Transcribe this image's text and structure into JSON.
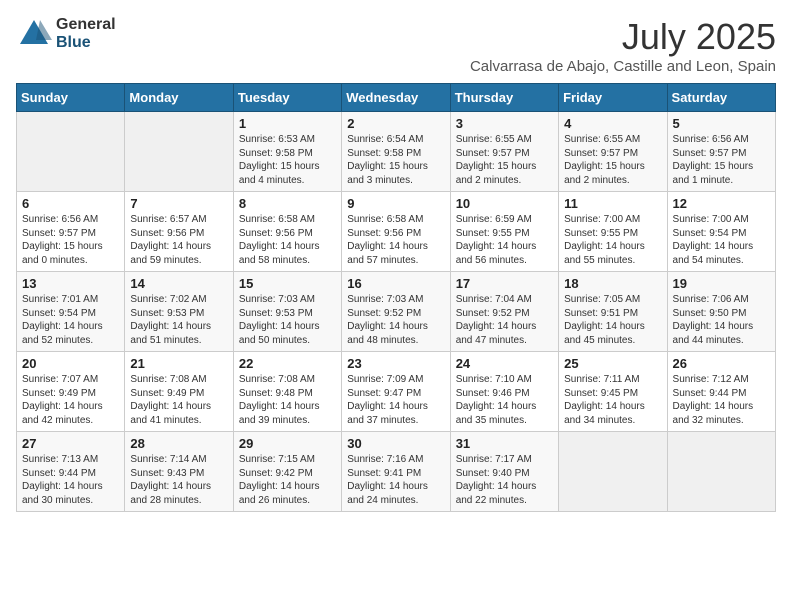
{
  "header": {
    "logo_general": "General",
    "logo_blue": "Blue",
    "title": "July 2025",
    "subtitle": "Calvarrasa de Abajo, Castille and Leon, Spain"
  },
  "days_of_week": [
    "Sunday",
    "Monday",
    "Tuesday",
    "Wednesday",
    "Thursday",
    "Friday",
    "Saturday"
  ],
  "weeks": [
    [
      {
        "day": "",
        "info": ""
      },
      {
        "day": "",
        "info": ""
      },
      {
        "day": "1",
        "info": "Sunrise: 6:53 AM\nSunset: 9:58 PM\nDaylight: 15 hours and 4 minutes."
      },
      {
        "day": "2",
        "info": "Sunrise: 6:54 AM\nSunset: 9:58 PM\nDaylight: 15 hours and 3 minutes."
      },
      {
        "day": "3",
        "info": "Sunrise: 6:55 AM\nSunset: 9:57 PM\nDaylight: 15 hours and 2 minutes."
      },
      {
        "day": "4",
        "info": "Sunrise: 6:55 AM\nSunset: 9:57 PM\nDaylight: 15 hours and 2 minutes."
      },
      {
        "day": "5",
        "info": "Sunrise: 6:56 AM\nSunset: 9:57 PM\nDaylight: 15 hours and 1 minute."
      }
    ],
    [
      {
        "day": "6",
        "info": "Sunrise: 6:56 AM\nSunset: 9:57 PM\nDaylight: 15 hours and 0 minutes."
      },
      {
        "day": "7",
        "info": "Sunrise: 6:57 AM\nSunset: 9:56 PM\nDaylight: 14 hours and 59 minutes."
      },
      {
        "day": "8",
        "info": "Sunrise: 6:58 AM\nSunset: 9:56 PM\nDaylight: 14 hours and 58 minutes."
      },
      {
        "day": "9",
        "info": "Sunrise: 6:58 AM\nSunset: 9:56 PM\nDaylight: 14 hours and 57 minutes."
      },
      {
        "day": "10",
        "info": "Sunrise: 6:59 AM\nSunset: 9:55 PM\nDaylight: 14 hours and 56 minutes."
      },
      {
        "day": "11",
        "info": "Sunrise: 7:00 AM\nSunset: 9:55 PM\nDaylight: 14 hours and 55 minutes."
      },
      {
        "day": "12",
        "info": "Sunrise: 7:00 AM\nSunset: 9:54 PM\nDaylight: 14 hours and 54 minutes."
      }
    ],
    [
      {
        "day": "13",
        "info": "Sunrise: 7:01 AM\nSunset: 9:54 PM\nDaylight: 14 hours and 52 minutes."
      },
      {
        "day": "14",
        "info": "Sunrise: 7:02 AM\nSunset: 9:53 PM\nDaylight: 14 hours and 51 minutes."
      },
      {
        "day": "15",
        "info": "Sunrise: 7:03 AM\nSunset: 9:53 PM\nDaylight: 14 hours and 50 minutes."
      },
      {
        "day": "16",
        "info": "Sunrise: 7:03 AM\nSunset: 9:52 PM\nDaylight: 14 hours and 48 minutes."
      },
      {
        "day": "17",
        "info": "Sunrise: 7:04 AM\nSunset: 9:52 PM\nDaylight: 14 hours and 47 minutes."
      },
      {
        "day": "18",
        "info": "Sunrise: 7:05 AM\nSunset: 9:51 PM\nDaylight: 14 hours and 45 minutes."
      },
      {
        "day": "19",
        "info": "Sunrise: 7:06 AM\nSunset: 9:50 PM\nDaylight: 14 hours and 44 minutes."
      }
    ],
    [
      {
        "day": "20",
        "info": "Sunrise: 7:07 AM\nSunset: 9:49 PM\nDaylight: 14 hours and 42 minutes."
      },
      {
        "day": "21",
        "info": "Sunrise: 7:08 AM\nSunset: 9:49 PM\nDaylight: 14 hours and 41 minutes."
      },
      {
        "day": "22",
        "info": "Sunrise: 7:08 AM\nSunset: 9:48 PM\nDaylight: 14 hours and 39 minutes."
      },
      {
        "day": "23",
        "info": "Sunrise: 7:09 AM\nSunset: 9:47 PM\nDaylight: 14 hours and 37 minutes."
      },
      {
        "day": "24",
        "info": "Sunrise: 7:10 AM\nSunset: 9:46 PM\nDaylight: 14 hours and 35 minutes."
      },
      {
        "day": "25",
        "info": "Sunrise: 7:11 AM\nSunset: 9:45 PM\nDaylight: 14 hours and 34 minutes."
      },
      {
        "day": "26",
        "info": "Sunrise: 7:12 AM\nSunset: 9:44 PM\nDaylight: 14 hours and 32 minutes."
      }
    ],
    [
      {
        "day": "27",
        "info": "Sunrise: 7:13 AM\nSunset: 9:44 PM\nDaylight: 14 hours and 30 minutes."
      },
      {
        "day": "28",
        "info": "Sunrise: 7:14 AM\nSunset: 9:43 PM\nDaylight: 14 hours and 28 minutes."
      },
      {
        "day": "29",
        "info": "Sunrise: 7:15 AM\nSunset: 9:42 PM\nDaylight: 14 hours and 26 minutes."
      },
      {
        "day": "30",
        "info": "Sunrise: 7:16 AM\nSunset: 9:41 PM\nDaylight: 14 hours and 24 minutes."
      },
      {
        "day": "31",
        "info": "Sunrise: 7:17 AM\nSunset: 9:40 PM\nDaylight: 14 hours and 22 minutes."
      },
      {
        "day": "",
        "info": ""
      },
      {
        "day": "",
        "info": ""
      }
    ]
  ]
}
